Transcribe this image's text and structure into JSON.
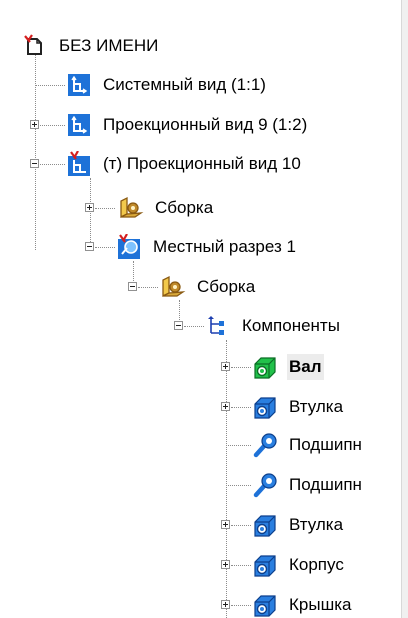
{
  "tree": {
    "root_label": "БЕЗ ИМЕНИ",
    "system_view": "Системный вид (1:1)",
    "projection_view_9": "Проекционный вид 9 (1:2)",
    "projection_view_10": "(т) Проекционный вид 10",
    "assembly_1": "Сборка",
    "local_section": "Местный разрез 1",
    "assembly_2": "Сборка",
    "components": "Компоненты",
    "items": [
      {
        "label": "Вал",
        "icon": "part-green-icon",
        "expandable": true,
        "selected": true
      },
      {
        "label": "Втулка",
        "icon": "part-blue-icon",
        "expandable": true,
        "selected": false
      },
      {
        "label": "Подшипн",
        "icon": "standard-part-icon",
        "expandable": false,
        "selected": false
      },
      {
        "label": "Подшипн",
        "icon": "standard-part-icon",
        "expandable": false,
        "selected": false
      },
      {
        "label": "Втулка",
        "icon": "part-blue-icon",
        "expandable": true,
        "selected": false
      },
      {
        "label": "Корпус",
        "icon": "part-blue-icon",
        "expandable": true,
        "selected": false
      },
      {
        "label": "Крышка",
        "icon": "part-blue-icon",
        "expandable": true,
        "selected": false
      }
    ]
  },
  "colors": {
    "view_icon_blue": "#1e72d8",
    "view_icon_green": "#1a9a3a",
    "marker_red": "#d42020",
    "assembly_brown": "#8a5a12",
    "part_green": "#21c14a",
    "part_blue": "#2a7fe0"
  }
}
